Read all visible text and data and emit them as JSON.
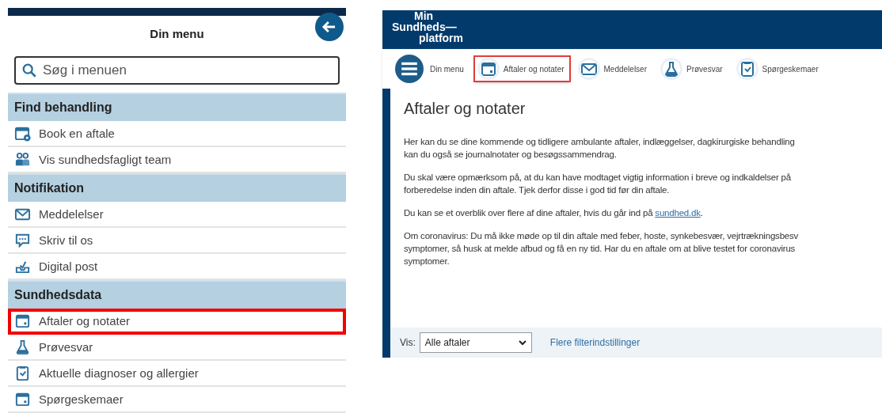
{
  "mobile_menu": {
    "title": "Din menu",
    "search": {
      "placeholder": "Søg i menuen"
    },
    "sections": [
      {
        "heading": "Find behandling",
        "items": [
          {
            "label": "Book en aftale",
            "kind": "calendar-plus",
            "highlighted": false
          },
          {
            "label": "Vis sundhedsfagligt team",
            "kind": "people",
            "highlighted": false
          }
        ]
      },
      {
        "heading": "Notifikation",
        "items": [
          {
            "label": "Meddelelser",
            "kind": "envelope",
            "highlighted": false
          },
          {
            "label": "Skriv til os",
            "kind": "chat",
            "highlighted": false
          },
          {
            "label": "Digital post",
            "kind": "inbox",
            "highlighted": false
          }
        ]
      },
      {
        "heading": "Sundhedsdata",
        "items": [
          {
            "label": "Aftaler og notater",
            "kind": "calendar",
            "highlighted": true
          },
          {
            "label": "Prøvesvar",
            "kind": "flask",
            "highlighted": false
          },
          {
            "label": "Aktuelle diagnoser og allergier",
            "kind": "clipboard",
            "highlighted": false
          },
          {
            "label": "Spørgeskemaer",
            "kind": "calendar",
            "highlighted": false
          }
        ]
      }
    ]
  },
  "desktop": {
    "logo": [
      "Min",
      "Sundheds—",
      "platform"
    ],
    "nav": [
      {
        "label": "Din menu",
        "kind": "menu",
        "highlighted": false
      },
      {
        "label": "Aftaler og notater",
        "kind": "calendar",
        "highlighted": true
      },
      {
        "label": "Meddelelser",
        "kind": "envelope",
        "highlighted": false
      },
      {
        "label": "Prøvesvar",
        "kind": "flask",
        "highlighted": false
      },
      {
        "label": "Spørgeskemaer",
        "kind": "clipboard",
        "highlighted": false
      }
    ],
    "heading": "Aftaler og notater",
    "paragraphs": [
      {
        "lines": [
          "Her kan du se dine kommende og tidligere ambulante aftaler, indlæggelser, dagkirurgiske behandling",
          "kan du også se journalnotater og besøgssammendrag."
        ]
      },
      {
        "lines": [
          "Du skal være opmærksom på, at du kan have modtaget vigtig information i breve og indkaldelser på",
          "forberedelse inden din aftale. Tjek derfor disse i god tid før din aftale."
        ]
      },
      {
        "lines": [
          "Du kan se et overblik over flere af dine aftaler, hvis du går ind på"
        ],
        "link": "sundhed.dk",
        "after": "."
      },
      {
        "lines": [
          "Om coronavirus: Du må ikke møde op til din aftale med feber, hoste, synkebesvær, vejrtrækningsbesv",
          "symptomer, så husk at melde afbud og få en ny tid. Har du en aftale om at blive testet for coronavirus",
          "symptomer."
        ]
      }
    ],
    "filter": {
      "label": "Vis:",
      "value": "Alle aftaler",
      "link": "Flere filterindstillinger"
    }
  }
}
